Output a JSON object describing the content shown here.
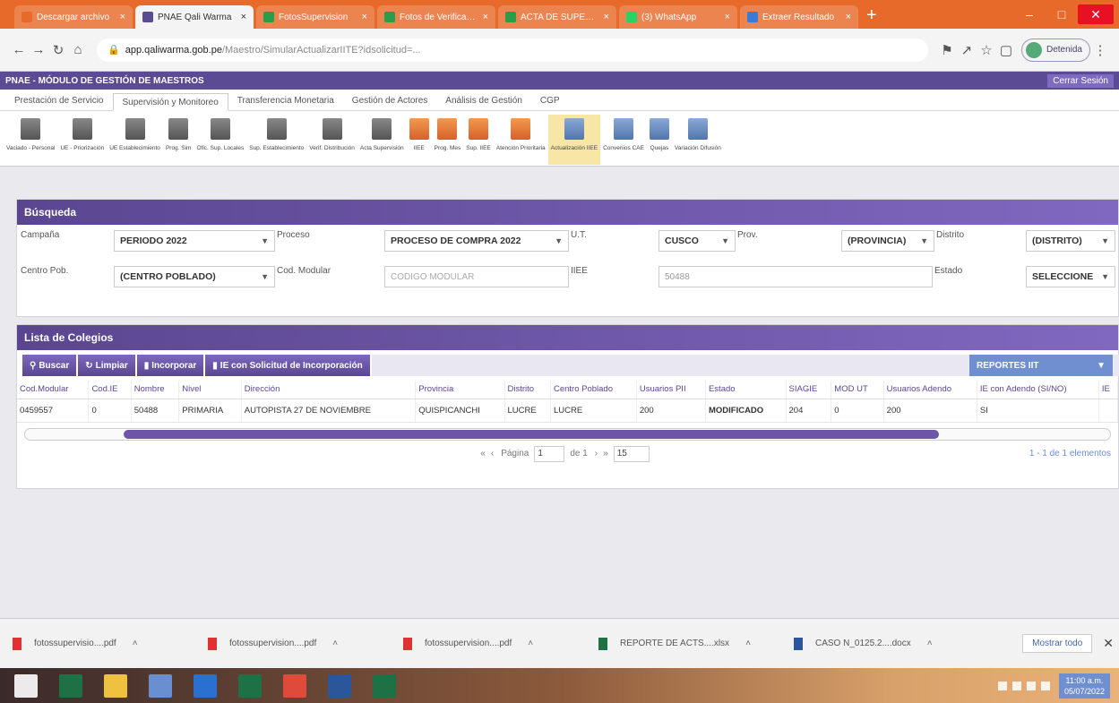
{
  "browser": {
    "tabs": [
      {
        "label": "Descargar archivo",
        "color": "#e86a2a"
      },
      {
        "label": "PNAE Qali Warma",
        "color": "#5b4a94"
      },
      {
        "label": "FotosSupervision",
        "color": "#2a9d4a"
      },
      {
        "label": "Fotos de Verificación",
        "color": "#2a9d4a"
      },
      {
        "label": "ACTA DE SUPERVISIÓN",
        "color": "#2a9d4a"
      },
      {
        "label": "(3) WhatsApp",
        "color": "#25d366"
      },
      {
        "label": "Extraer Resultado",
        "color": "#3b7bd6"
      }
    ],
    "url_host": "app.qaliwarma.gob.pe",
    "url_path": "/Maestro/SimularActualizarIITE?idsolicitud=...",
    "profile_label": "Detenida"
  },
  "app": {
    "title": "PNAE - MÓDULO DE GESTIÓN DE MAESTROS",
    "logout_label": "Cerrar Sesión",
    "menu_tabs": [
      "Prestación de Servicio",
      "Supervisión y Monitoreo",
      "Transferencia Monetaria",
      "Gestión de Actores",
      "Análisis de Gestión",
      "CGP"
    ],
    "active_menu_tab": 1,
    "toolbar": [
      {
        "label": "Vaciado - Personal",
        "icon": "grey"
      },
      {
        "label": "UE - Priorización",
        "icon": "grey"
      },
      {
        "label": "UE Establecimiento",
        "icon": "grey"
      },
      {
        "label": "Prog. Sim",
        "icon": "grey"
      },
      {
        "label": "Ofic. Sup. Locales",
        "icon": "grey"
      },
      {
        "label": "Sup. Establecimiento",
        "icon": "grey"
      },
      {
        "label": "Verif. Distribución",
        "icon": "grey"
      },
      {
        "label": "Acta Supervisión",
        "icon": "grey"
      },
      {
        "label": "IIEE",
        "icon": "orange"
      },
      {
        "label": "Prog. Mes",
        "icon": "orange"
      },
      {
        "label": "Sup. IIEE",
        "icon": "orange"
      },
      {
        "label": "Atención Prioritaria",
        "icon": "orange"
      },
      {
        "label": "Actualización IIEE",
        "icon": "blue"
      },
      {
        "label": "Convenios CAE",
        "icon": "blue"
      },
      {
        "label": "Quejas",
        "icon": "blue"
      },
      {
        "label": "Variación Difusión",
        "icon": "blue"
      }
    ],
    "active_tool": 12
  },
  "search": {
    "title": "Búsqueda",
    "campana_label": "Campaña",
    "campana_value": "PERIODO 2022",
    "proceso_label": "Proceso",
    "proceso_value": "PROCESO DE COMPRA 2022",
    "ut_label": "U.T.",
    "ut_value": "CUSCO",
    "prov_label": "Prov.",
    "prov_value": "(PROVINCIA)",
    "distrito_label": "Distrito",
    "distrito_value": "(DISTRITO)",
    "centro_label": "Centro Pob.",
    "centro_value": "(CENTRO POBLADO)",
    "cod_label": "Cod. Modular",
    "cod_placeholder": "CODIGO MODULAR",
    "iiee_label": "IIEE",
    "iiee_value": "50488",
    "estado_label": "Estado",
    "estado_value": "SELECCIONE"
  },
  "list": {
    "title": "Lista de Colegios",
    "buttons": [
      "Buscar",
      "Limpiar",
      "Incorporar",
      "IE con Solicitud de Incorporación"
    ],
    "report_label": "REPORTES IIT",
    "columns": [
      "Cod.Modular",
      "Cod.IE",
      "Nombre",
      "Nivel",
      "Dirección",
      "Provincia",
      "Distrito",
      "Centro Poblado",
      "Usuarios PII",
      "Estado",
      "SIAGIE",
      "MOD UT",
      "Usuarios Adendo",
      "IE con Adendo (SI/NO)",
      "IE"
    ],
    "rows": [
      [
        "0459557",
        "0",
        "50488",
        "PRIMARIA",
        "AUTOPISTA 27 DE NOVIEMBRE",
        "QUISPICANCHI",
        "LUCRE",
        "LUCRE",
        "200",
        "MODIFICADO",
        "204",
        "0",
        "200",
        "SI",
        ""
      ]
    ],
    "pager_label": "Página",
    "page": "1",
    "of_label": "de 1",
    "page_size": "15",
    "count_label": "1 - 1 de 1 elementos"
  },
  "downloads": [
    {
      "name": "fotossupervisio....pdf",
      "type": "pdf"
    },
    {
      "name": "fotossupervision....pdf",
      "type": "pdf"
    },
    {
      "name": "fotossupervision....pdf",
      "type": "pdf"
    },
    {
      "name": "REPORTE DE ACTS....xlsx",
      "type": "xls"
    },
    {
      "name": "CASO N_0125.2....docx",
      "type": "doc"
    }
  ],
  "show_all_label": "Mostrar todo",
  "taskbar": {
    "time": "11:00 a.m.",
    "date": "05/07/2022"
  }
}
